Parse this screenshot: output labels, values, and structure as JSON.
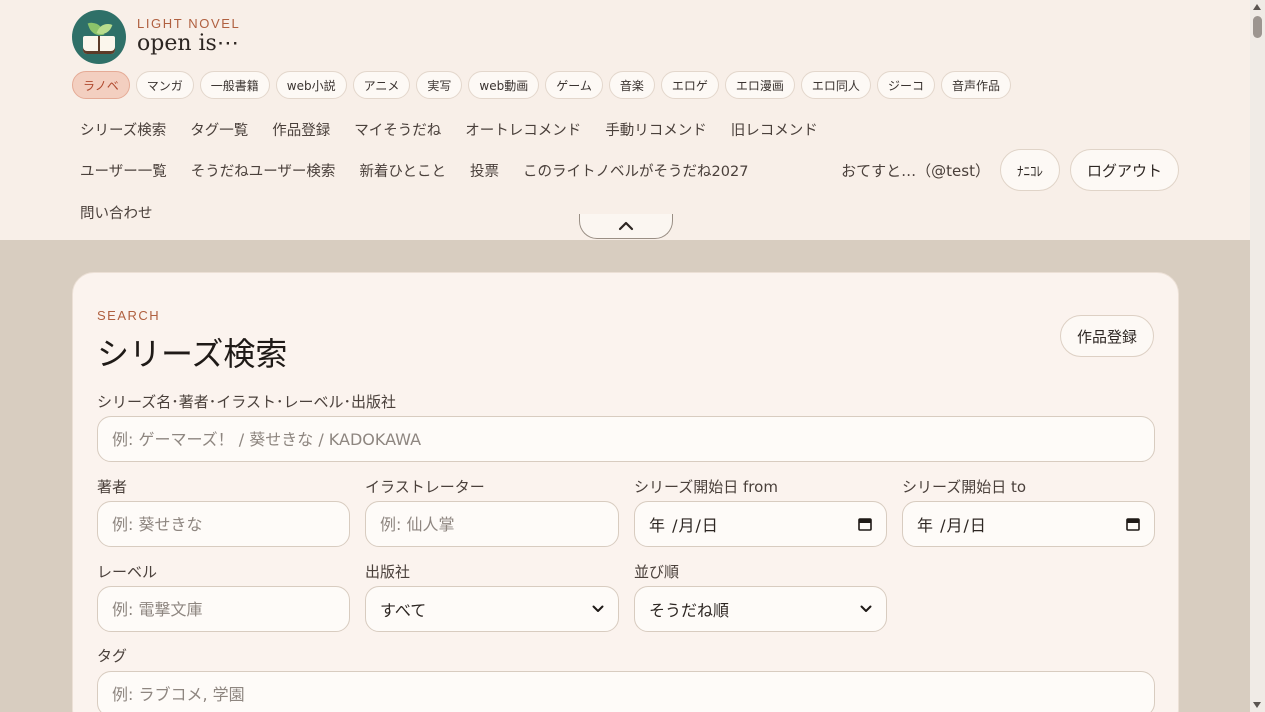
{
  "logo": {
    "sub": "LIGHT NOVEL",
    "title": "open is⋯"
  },
  "categories": [
    {
      "label": "ラノベ",
      "active": true
    },
    {
      "label": "マンガ"
    },
    {
      "label": "一般書籍"
    },
    {
      "label": "web小説"
    },
    {
      "label": "アニメ"
    },
    {
      "label": "実写"
    },
    {
      "label": "web動画"
    },
    {
      "label": "ゲーム"
    },
    {
      "label": "音楽"
    },
    {
      "label": "エロゲ"
    },
    {
      "label": "エロ漫画"
    },
    {
      "label": "エロ同人"
    },
    {
      "label": "ジーコ"
    },
    {
      "label": "音声作品"
    }
  ],
  "nav1": [
    "シリーズ検索",
    "タグ一覧",
    "作品登録",
    "マイそうだね",
    "オートレコメンド",
    "手動リコメンド",
    "旧レコメンド"
  ],
  "nav2": [
    "ユーザー一覧",
    "そうだねユーザー検索",
    "新着ひとこと",
    "投票",
    "このライトノベルがそうだね2027"
  ],
  "nav3": [
    "問い合わせ"
  ],
  "user": {
    "name": "おてすと…（@test）",
    "nanikore_label": "ﾅﾆｺﾚ",
    "logout_label": "ログアウト"
  },
  "search": {
    "kicker": "SEARCH",
    "title": "シリーズ検索",
    "register_label": "作品登録",
    "main_label": "シリーズ名･著者･イラスト･レーベル･出版社",
    "main_placeholder": "例: ゲーマーズ！ / 葵せきな / KADOKAWA",
    "author_label": "著者",
    "author_placeholder": "例: 葵せきな",
    "illustrator_label": "イラストレーター",
    "illustrator_placeholder": "例: 仙人掌",
    "from_label": "シリーズ開始日 from",
    "from_value": "年 /月/日",
    "to_label": "シリーズ開始日 to",
    "to_value": "年 /月/日",
    "label_label": "レーベル",
    "label_placeholder": "例: 電撃文庫",
    "publisher_label": "出版社",
    "publisher_value": "すべて",
    "sort_label": "並び順",
    "sort_value": "そうだね順",
    "tag_label": "タグ",
    "tag_placeholder": "例: ラブコメ, 学園"
  }
}
